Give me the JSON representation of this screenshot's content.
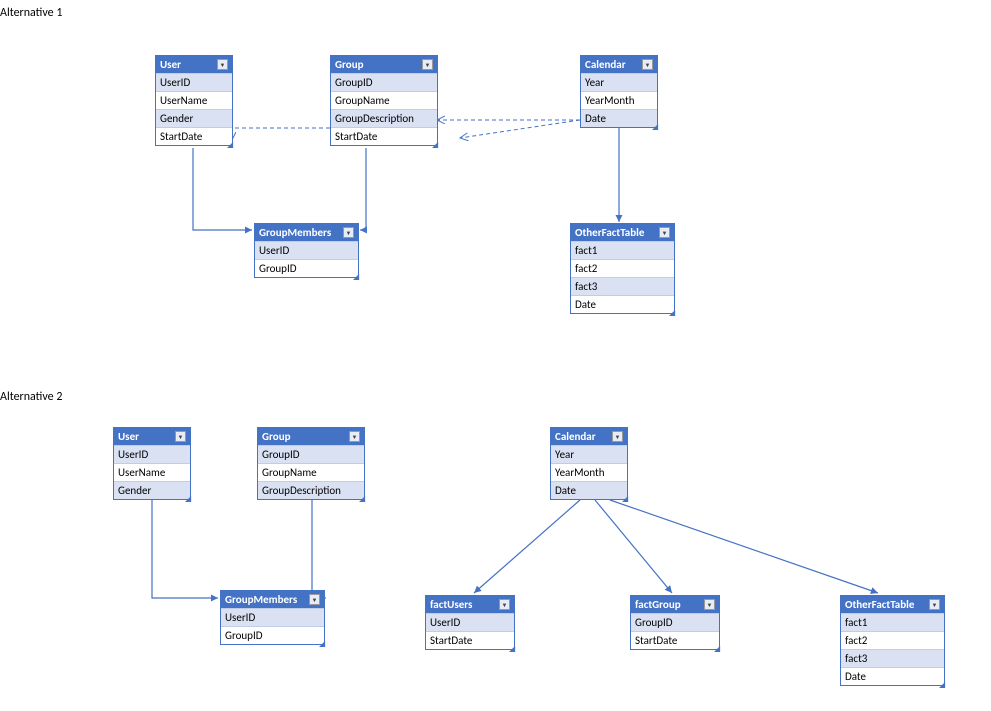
{
  "labels": {
    "alt1": "Alternative 1",
    "alt2": "Alternative 2"
  },
  "alt1": {
    "user": {
      "title": "User",
      "rows": [
        "UserID",
        "UserName",
        "Gender",
        "StartDate"
      ]
    },
    "group": {
      "title": "Group",
      "rows": [
        "GroupID",
        "GroupName",
        "GroupDescription",
        "StartDate"
      ]
    },
    "calendar": {
      "title": "Calendar",
      "rows": [
        "Year",
        "YearMonth",
        "Date"
      ]
    },
    "groupMembers": {
      "title": "GroupMembers",
      "rows": [
        "UserID",
        "GroupID"
      ]
    },
    "otherFact": {
      "title": "OtherFactTable",
      "rows": [
        "fact1",
        "fact2",
        "fact3",
        "Date"
      ]
    }
  },
  "alt2": {
    "user": {
      "title": "User",
      "rows": [
        "UserID",
        "UserName",
        "Gender"
      ]
    },
    "group": {
      "title": "Group",
      "rows": [
        "GroupID",
        "GroupName",
        "GroupDescription"
      ]
    },
    "calendar": {
      "title": "Calendar",
      "rows": [
        "Year",
        "YearMonth",
        "Date"
      ]
    },
    "groupMembers": {
      "title": "GroupMembers",
      "rows": [
        "UserID",
        "GroupID"
      ]
    },
    "factUsers": {
      "title": "factUsers",
      "rows": [
        "UserID",
        "StartDate"
      ]
    },
    "factGroup": {
      "title": "factGroup",
      "rows": [
        "GroupID",
        "StartDate"
      ]
    },
    "otherFact": {
      "title": "OtherFactTable",
      "rows": [
        "fact1",
        "fact2",
        "fact3",
        "Date"
      ]
    }
  }
}
